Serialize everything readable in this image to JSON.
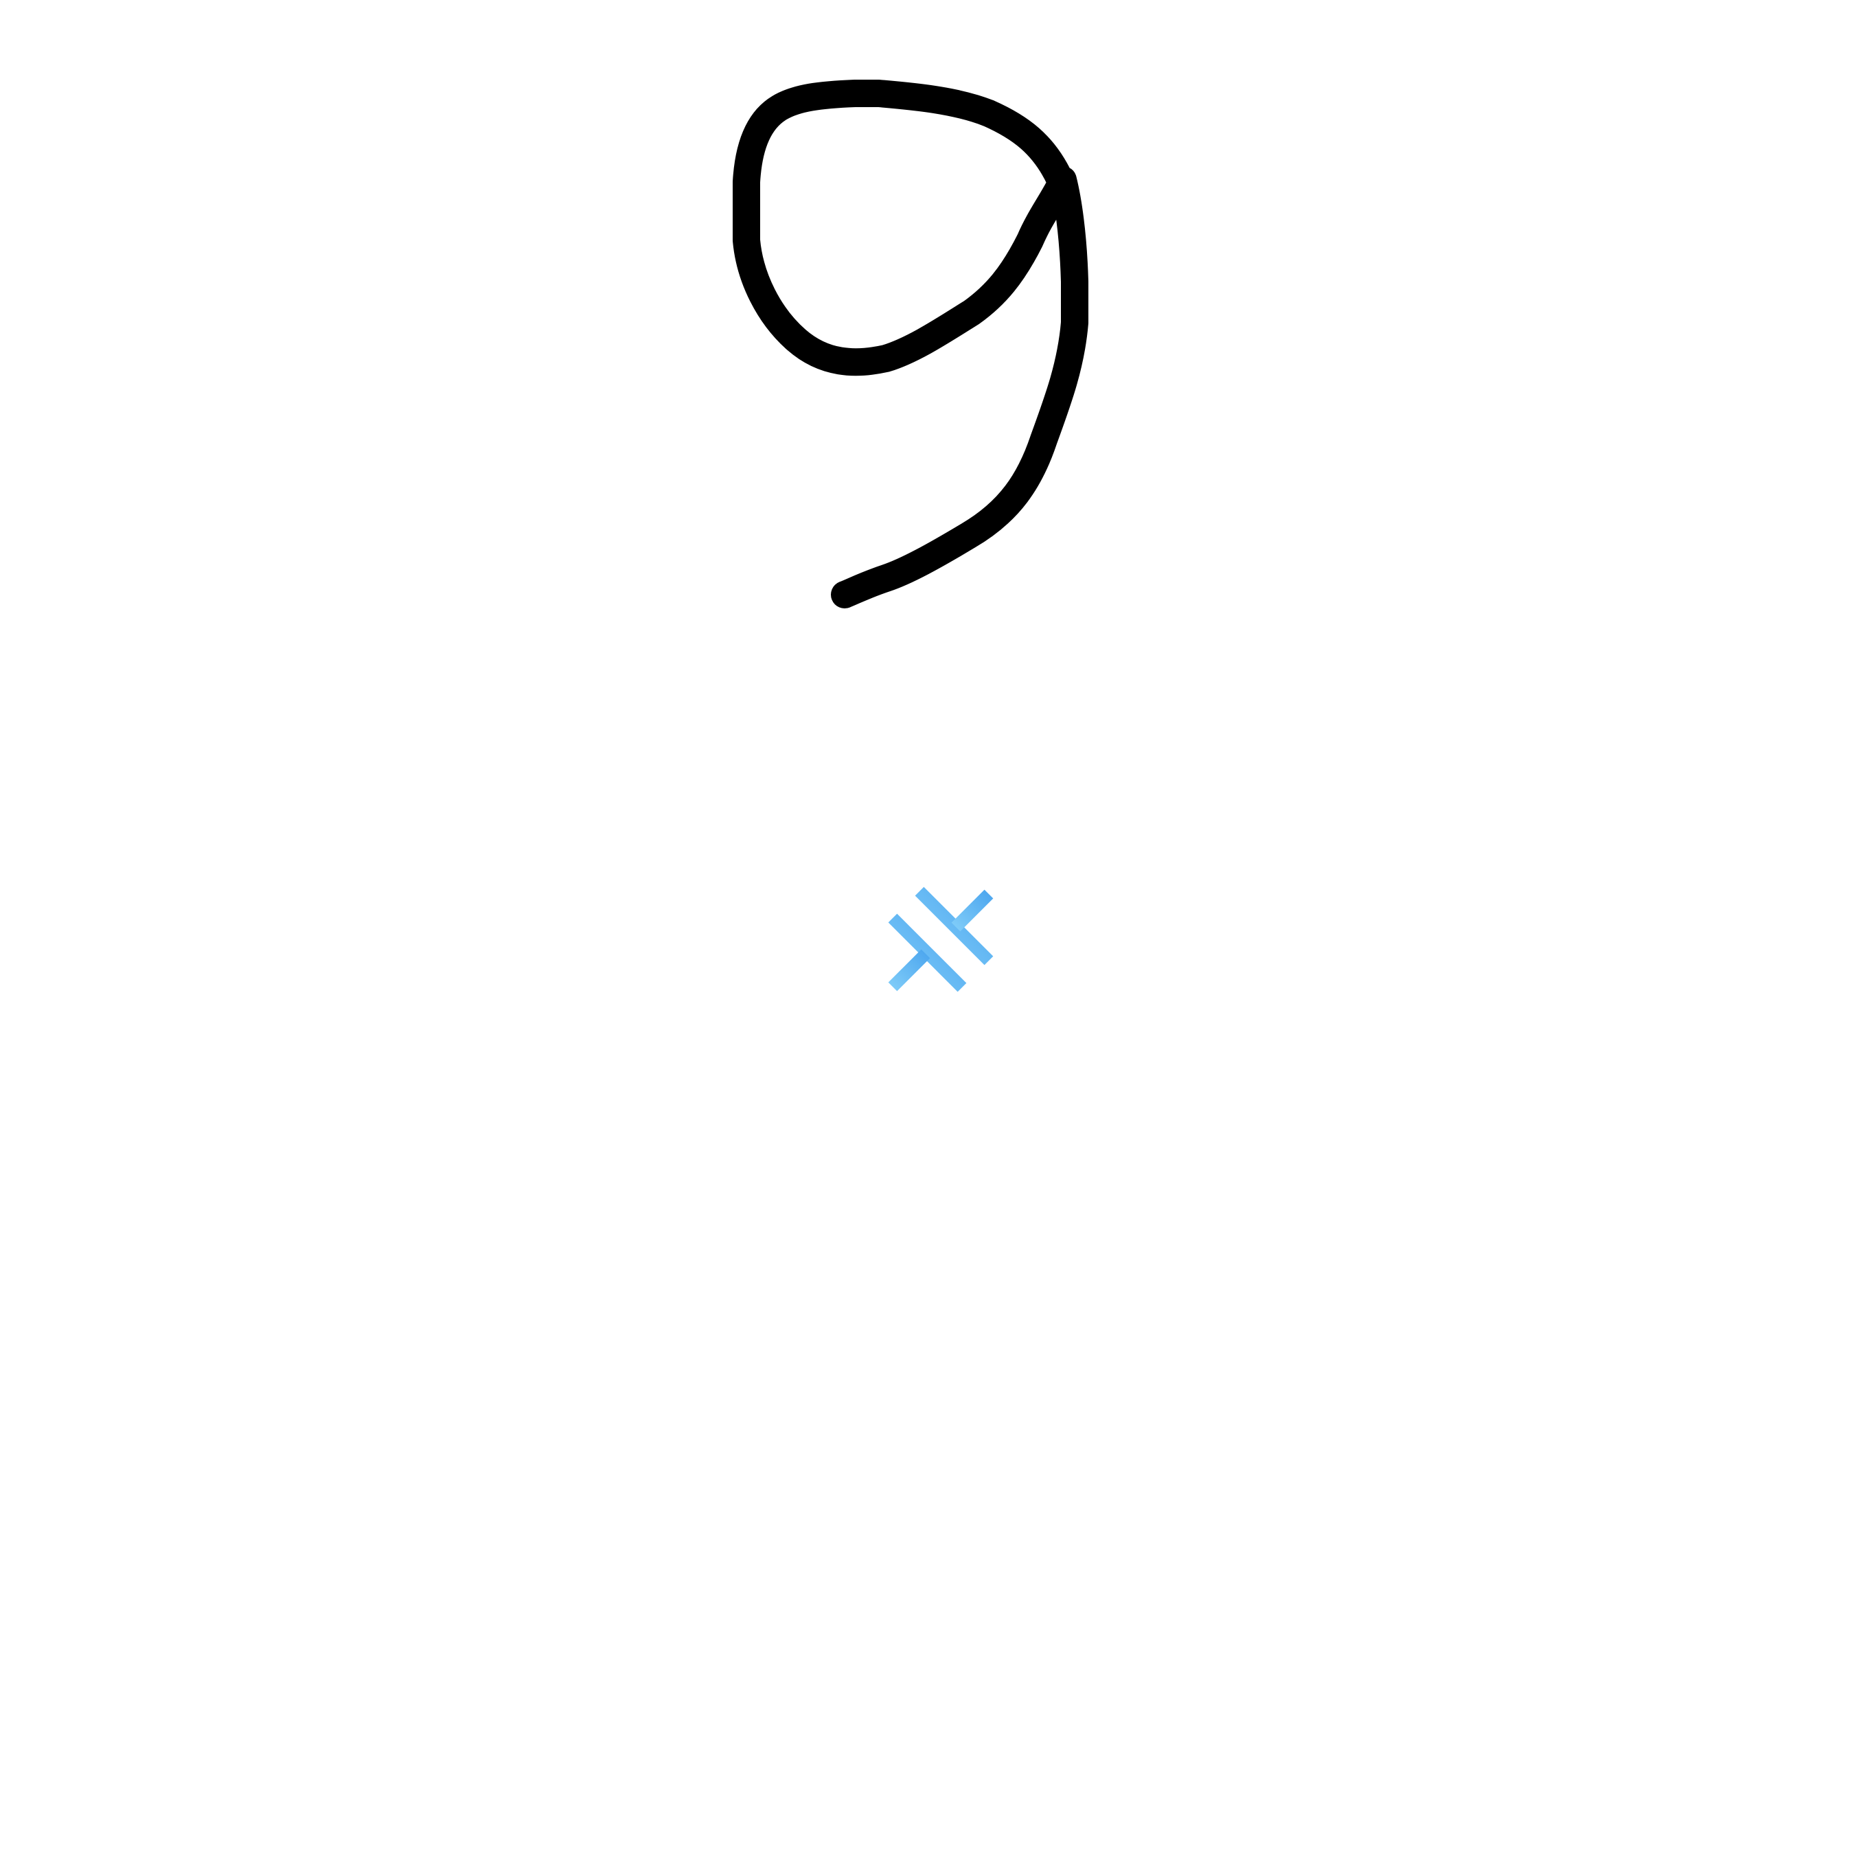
{
  "canvas": {
    "background_color": "#ffffff"
  },
  "drawing": {
    "description_kind": "handwritten stroke",
    "stroke_color": "#000000"
  },
  "center_icon": {
    "name": "expand-collapse-icon",
    "colors": {
      "light": "#7ecbf8",
      "dark": "#4fa8ef"
    }
  }
}
